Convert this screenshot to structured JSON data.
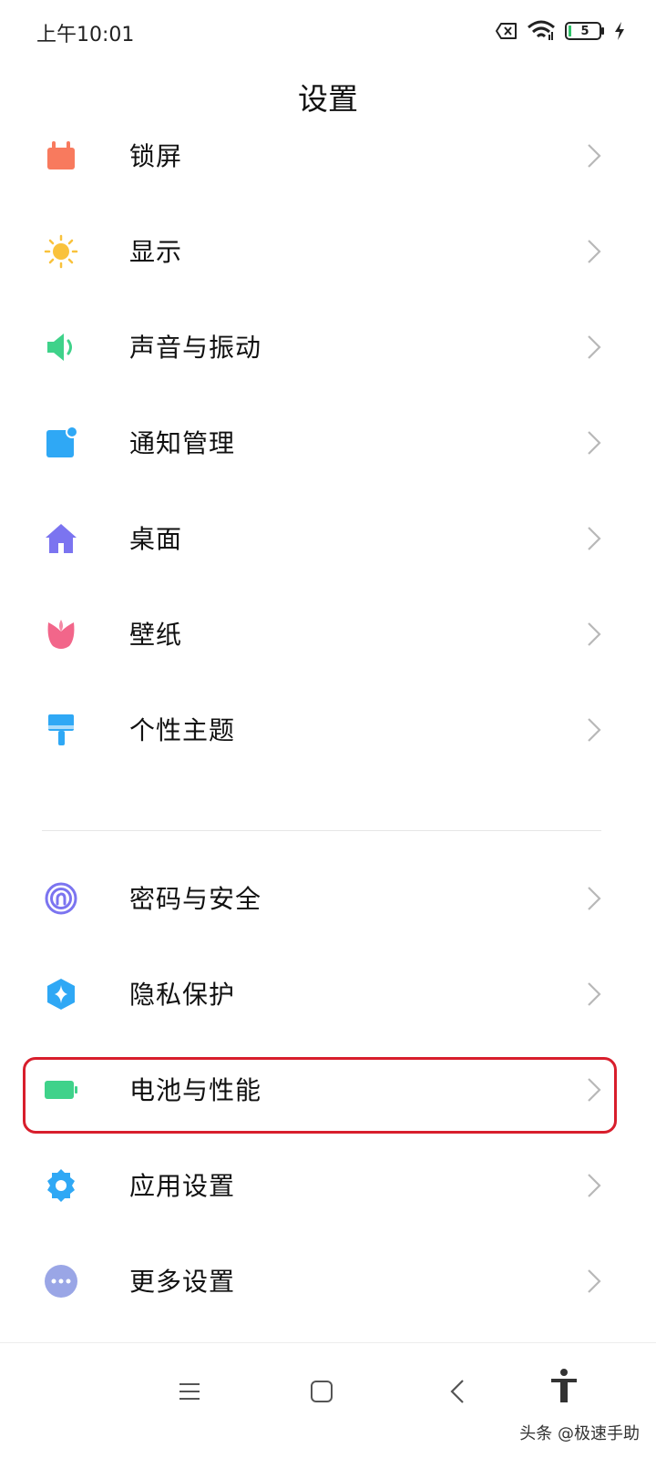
{
  "status_bar": {
    "time": "上午10:01",
    "battery_level": "5",
    "icons": [
      "sim-off-icon",
      "wifi-icon",
      "battery-icon",
      "charging-icon"
    ]
  },
  "header": {
    "title": "设置"
  },
  "settings": {
    "items": [
      {
        "label": "锁屏",
        "icon": "lock-screen-icon",
        "color": "#f87a5e"
      },
      {
        "label": "显示",
        "icon": "sun-icon",
        "color": "#f9c23c"
      },
      {
        "label": "声音与振动",
        "icon": "speaker-icon",
        "color": "#3fd28a"
      },
      {
        "label": "通知管理",
        "icon": "notification-icon",
        "color": "#2fa8f5"
      },
      {
        "label": "桌面",
        "icon": "home-icon",
        "color": "#7b74f0"
      },
      {
        "label": "壁纸",
        "icon": "tulip-icon",
        "color": "#f2668a"
      },
      {
        "label": "个性主题",
        "icon": "paint-brush-icon",
        "color": "#2fa8f5"
      },
      {
        "label": "密码与安全",
        "icon": "fingerprint-icon",
        "color": "#7b74f0"
      },
      {
        "label": "隐私保护",
        "icon": "privacy-shield-icon",
        "color": "#2fa8f5"
      },
      {
        "label": "电池与性能",
        "icon": "battery-performance-icon",
        "color": "#3fd28a"
      },
      {
        "label": "应用设置",
        "icon": "gear-icon",
        "color": "#2fa8f5"
      },
      {
        "label": "更多设置",
        "icon": "more-icon",
        "color": "#9aa6e6"
      }
    ]
  },
  "highlight_color": "#d81e2c",
  "nav_bar": {
    "icons": [
      "menu-icon",
      "home-square-icon",
      "back-icon",
      "accessibility-icon"
    ],
    "watermark": "头条 @极速手助"
  }
}
